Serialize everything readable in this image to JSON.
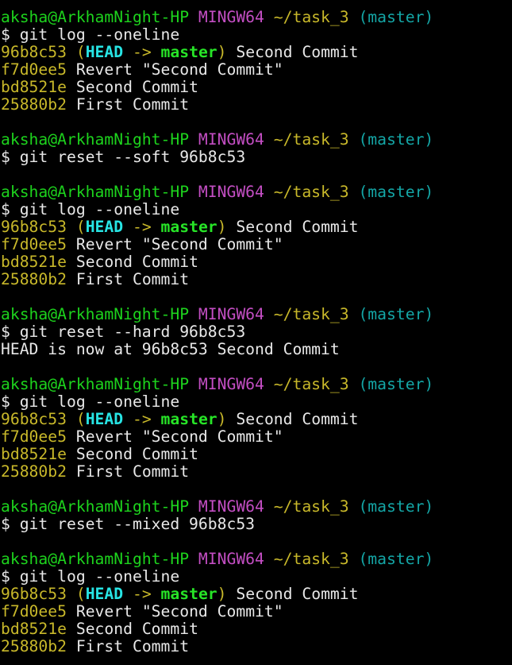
{
  "prompt": {
    "user_host": "aksha@ArkhamNight-HP",
    "system": "MINGW64",
    "path": "~/task_3",
    "branch": "(master)"
  },
  "colors": {
    "background": "#000000",
    "text": "#e8e8e8",
    "user_host": "#1dd31d",
    "system": "#c34ec3",
    "path": "#c8b82a",
    "branch": "#14a6a6",
    "commit_hash": "#c8b82a",
    "head_ref": "#27e4e4",
    "master_ref": "#27e427"
  },
  "log": {
    "paren_open": "(",
    "head": "HEAD",
    "arrow": " -> ",
    "master": "master",
    "paren_close": ")",
    "commits": [
      {
        "hash": "96b8c53",
        "message": "Second Commit"
      },
      {
        "hash": "f7d0ee5",
        "message": "Revert \"Second Commit\""
      },
      {
        "hash": "bd8521e",
        "message": "Second Commit"
      },
      {
        "hash": "25880b2",
        "message": "First Commit"
      }
    ]
  },
  "commands": [
    "$ git log --oneline",
    "$ git reset --soft 96b8c53",
    "$ git log --oneline",
    "$ git reset --hard 96b8c53",
    "$ git log --oneline",
    "$ git reset --mixed 96b8c53",
    "$ git log --oneline"
  ],
  "hard_reset_output": "HEAD is now at 96b8c53 Second Commit"
}
